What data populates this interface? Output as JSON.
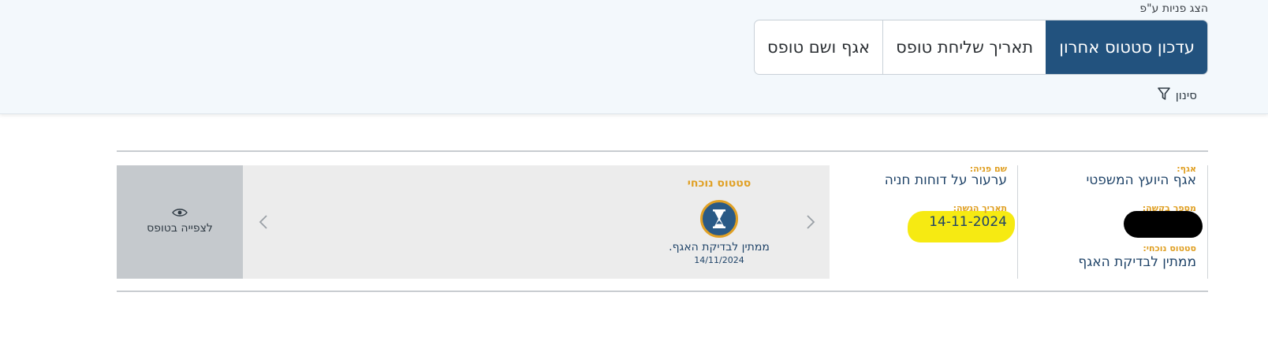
{
  "sort": {
    "label": "הצג פניות ע\"פ",
    "options": [
      "עדכון סטטוס אחרון",
      "תאריך שליחת טופס",
      "אגף ושם טופס"
    ]
  },
  "filter": {
    "label": "סינון",
    "icon": "filter-icon"
  },
  "request": {
    "dept_label": "אגף:",
    "dept_value": "אגף היועץ המשפטי",
    "number_label": "מספר בקשה:",
    "status_label": "סטטוס נוכחי:",
    "status_value": "ממתין לבדיקת האגף",
    "name_label": "שם פניה:",
    "name_value": "ערעור על דוחות חניה",
    "submit_label": "תאריך הגשה:",
    "submit_value": "14-11-2024"
  },
  "status_panel": {
    "title": "סטטוס נוכחי",
    "icon": "hourglass-icon",
    "text": "ממתין לבדיקת האגף.",
    "date": "14/11/2024"
  },
  "view": {
    "label": "לצפייה בטופס",
    "icon": "eye-icon"
  },
  "colors": {
    "primary": "#22527e",
    "accent": "#e0a024",
    "highlight": "#f6ea12"
  }
}
